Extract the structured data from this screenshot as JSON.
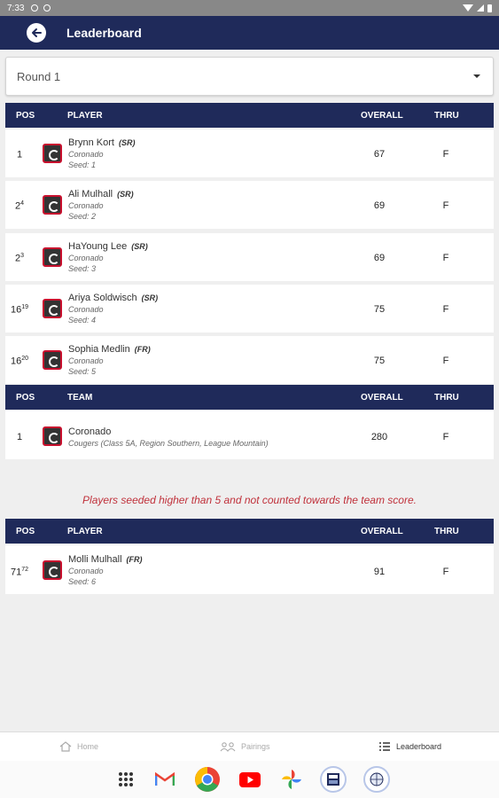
{
  "status_bar": {
    "time": "7:33"
  },
  "app_bar": {
    "title": "Leaderboard"
  },
  "round_select": {
    "value": "Round 1"
  },
  "player_header": {
    "pos": "POS",
    "player": "PLAYER",
    "overall": "OVERALL",
    "thru": "THRU"
  },
  "team_header": {
    "pos": "POS",
    "team": "TEAM",
    "overall": "OVERALL",
    "thru": "THRU"
  },
  "players": [
    {
      "pos": "1",
      "pos_sup": "",
      "name": "Brynn Kort",
      "class": "(SR)",
      "school": "Coronado",
      "seed": "Seed: 1",
      "overall": "67",
      "thru": "F"
    },
    {
      "pos": "2",
      "pos_sup": "4",
      "name": "Ali Mulhall",
      "class": "(SR)",
      "school": "Coronado",
      "seed": "Seed: 2",
      "overall": "69",
      "thru": "F"
    },
    {
      "pos": "2",
      "pos_sup": "3",
      "name": "HaYoung Lee",
      "class": "(SR)",
      "school": "Coronado",
      "seed": "Seed: 3",
      "overall": "69",
      "thru": "F"
    },
    {
      "pos": "16",
      "pos_sup": "19",
      "name": "Ariya Soldwisch",
      "class": "(SR)",
      "school": "Coronado",
      "seed": "Seed: 4",
      "overall": "75",
      "thru": "F"
    },
    {
      "pos": "16",
      "pos_sup": "20",
      "name": "Sophia Medlin",
      "class": "(FR)",
      "school": "Coronado",
      "seed": "Seed: 5",
      "overall": "75",
      "thru": "F"
    }
  ],
  "team": {
    "pos": "1",
    "name": "Coronado",
    "desc": "Cougers (Class 5A, Region Southern, League Mountain)",
    "overall": "280",
    "thru": "F"
  },
  "note": "Players seeded higher than 5 and not counted towards the team score.",
  "extra_header": {
    "pos": "POS",
    "player": "PLAYER",
    "overall": "OVERALL",
    "thru": "THRU"
  },
  "extra_players": [
    {
      "pos": "71",
      "pos_sup": "72",
      "name": "Molli Mulhall",
      "class": "(FR)",
      "school": "Coronado",
      "seed": "Seed: 6",
      "overall": "91",
      "thru": "F"
    }
  ],
  "bottom_nav": {
    "home": "Home",
    "pairings": "Pairings",
    "leaderboard": "Leaderboard"
  },
  "colors": {
    "primary": "#1f2a5a",
    "note": "#c0313b",
    "logo_border": "#c8102e"
  },
  "icons": [
    "back-arrow-icon",
    "caret-down-icon",
    "school-logo-icon",
    "home-icon",
    "pairings-icon",
    "leaderboard-list-icon",
    "apps-grid-icon",
    "gmail-icon",
    "chrome-icon",
    "youtube-icon",
    "photos-icon"
  ]
}
